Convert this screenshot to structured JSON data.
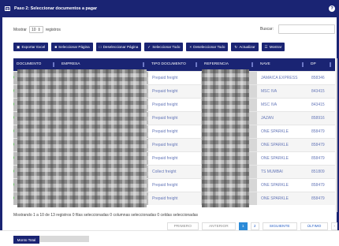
{
  "window": {
    "title": "Paso 2: Seleccionar documentos a pagar",
    "icon": "clipboard-icon",
    "help_icon": "?"
  },
  "controls": {
    "show_label": "Mostrar",
    "entries_value": "10",
    "entries_suffix": "registros",
    "search_label": "Buscar:",
    "search_value": ""
  },
  "toolbar": [
    {
      "label": "Exportar Excel",
      "icon": "file-excel-icon",
      "glyph": "▣"
    },
    {
      "label": "Seleccionar Página",
      "icon": "check-square-icon",
      "glyph": "■"
    },
    {
      "label": "Deseleccionar Página",
      "icon": "square-icon",
      "glyph": "□"
    },
    {
      "label": "Seleccionar Todo",
      "icon": "check-all-icon",
      "glyph": "✓"
    },
    {
      "label": "Deseleccionar Todo",
      "icon": "close-icon",
      "glyph": "×"
    },
    {
      "label": "Actualizar",
      "icon": "refresh-icon",
      "glyph": "↻"
    },
    {
      "label": "Mostrar",
      "icon": "list-icon",
      "glyph": "☰"
    }
  ],
  "table": {
    "headers": [
      "DOCUMENTO",
      "EMPRESA",
      "TIPO DOCUMENTO",
      "REFERENCIA",
      "NAVE",
      "DP"
    ],
    "rows": [
      {
        "tipo": "Prepaid freight",
        "nave": "JAMAICA EXPRESS",
        "dp": "858346"
      },
      {
        "tipo": "Prepaid freight",
        "nave": "MSC IVA",
        "dp": "843415"
      },
      {
        "tipo": "Prepaid freight",
        "nave": "MSC IVA",
        "dp": "843415"
      },
      {
        "tipo": "Prepaid freight",
        "nave": "JAZAN",
        "dp": "858916"
      },
      {
        "tipo": "Prepaid freight",
        "nave": "ONE SPARKLE",
        "dp": "858479"
      },
      {
        "tipo": "Prepaid freight",
        "nave": "ONE SPARKLE",
        "dp": "858479"
      },
      {
        "tipo": "Prepaid freight",
        "nave": "ONE SPARKLE",
        "dp": "858479"
      },
      {
        "tipo": "Collect freight",
        "nave": "TS MUMBAI",
        "dp": "851809"
      },
      {
        "tipo": "Prepaid freight",
        "nave": "ONE SPARKLE",
        "dp": "858479"
      },
      {
        "tipo": "Prepaid freight",
        "nave": "ONE SPARKLE",
        "dp": "858479"
      }
    ]
  },
  "footer": {
    "status": "Mostrando 1 a 10 de 13 registros   0 filas seleccionadas  0 columnas seleccionadas  0 celdas seleccionadas"
  },
  "pagination": {
    "first": "PRIMERO",
    "previous": "ANTERIOR",
    "page_1": "1",
    "page_2": "2",
    "next": "SIGUIENTE",
    "last": "ÚLTIMO",
    "more": "›"
  },
  "bottom": {
    "total_button": "Monto Total"
  },
  "colors": {
    "primary": "#1a2473",
    "active_page": "#2b8ad8",
    "link_text": "#6678b9",
    "selected_dot": "#61bd5c"
  }
}
